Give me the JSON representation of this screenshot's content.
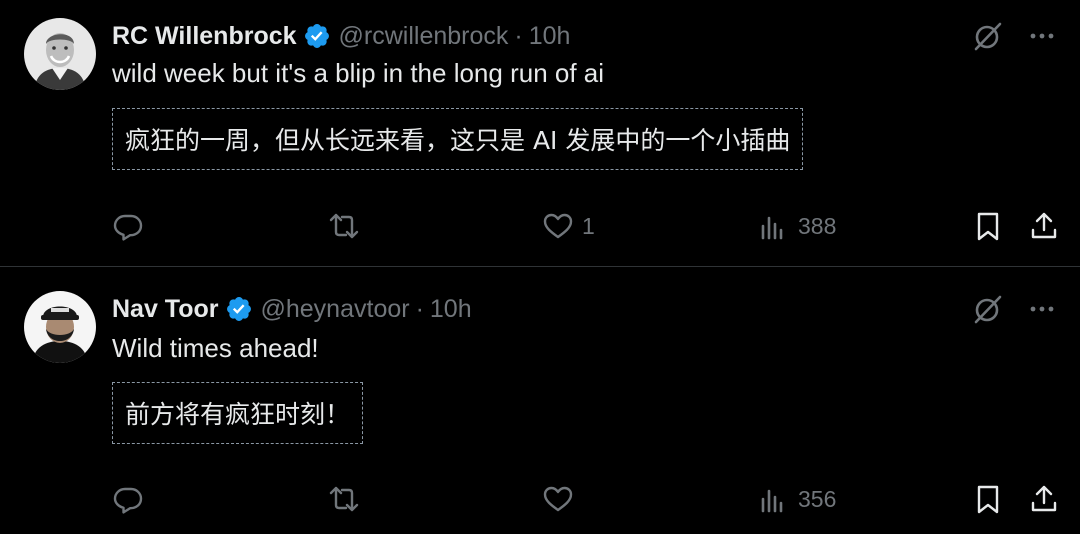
{
  "tweets": [
    {
      "name": "RC Willenbrock",
      "handle": "@rcwillenbrock",
      "separator": "·",
      "time": "10h",
      "text": "wild week but it's a blip in the long run of ai",
      "translation": "疯狂的一周，但从长远来看，这只是 AI 发展中的一个小插曲",
      "likes": "1",
      "views": "388",
      "replies": "",
      "retweets": ""
    },
    {
      "name": "Nav Toor",
      "handle": "@heynavtoor",
      "separator": "·",
      "time": "10h",
      "text": "Wild times ahead!",
      "translation": "前方将有疯狂时刻！",
      "likes": "",
      "views": "356",
      "replies": "",
      "retweets": ""
    }
  ],
  "colors": {
    "background": "#000000",
    "text": "#e7e9ea",
    "muted": "#71767b",
    "verified": "#1d9bf0",
    "divider": "#2f3336"
  },
  "icons": [
    "verified-badge-icon",
    "grok-icon",
    "more-icon",
    "reply-icon",
    "retweet-icon",
    "like-icon",
    "views-icon",
    "bookmark-icon",
    "share-icon"
  ]
}
